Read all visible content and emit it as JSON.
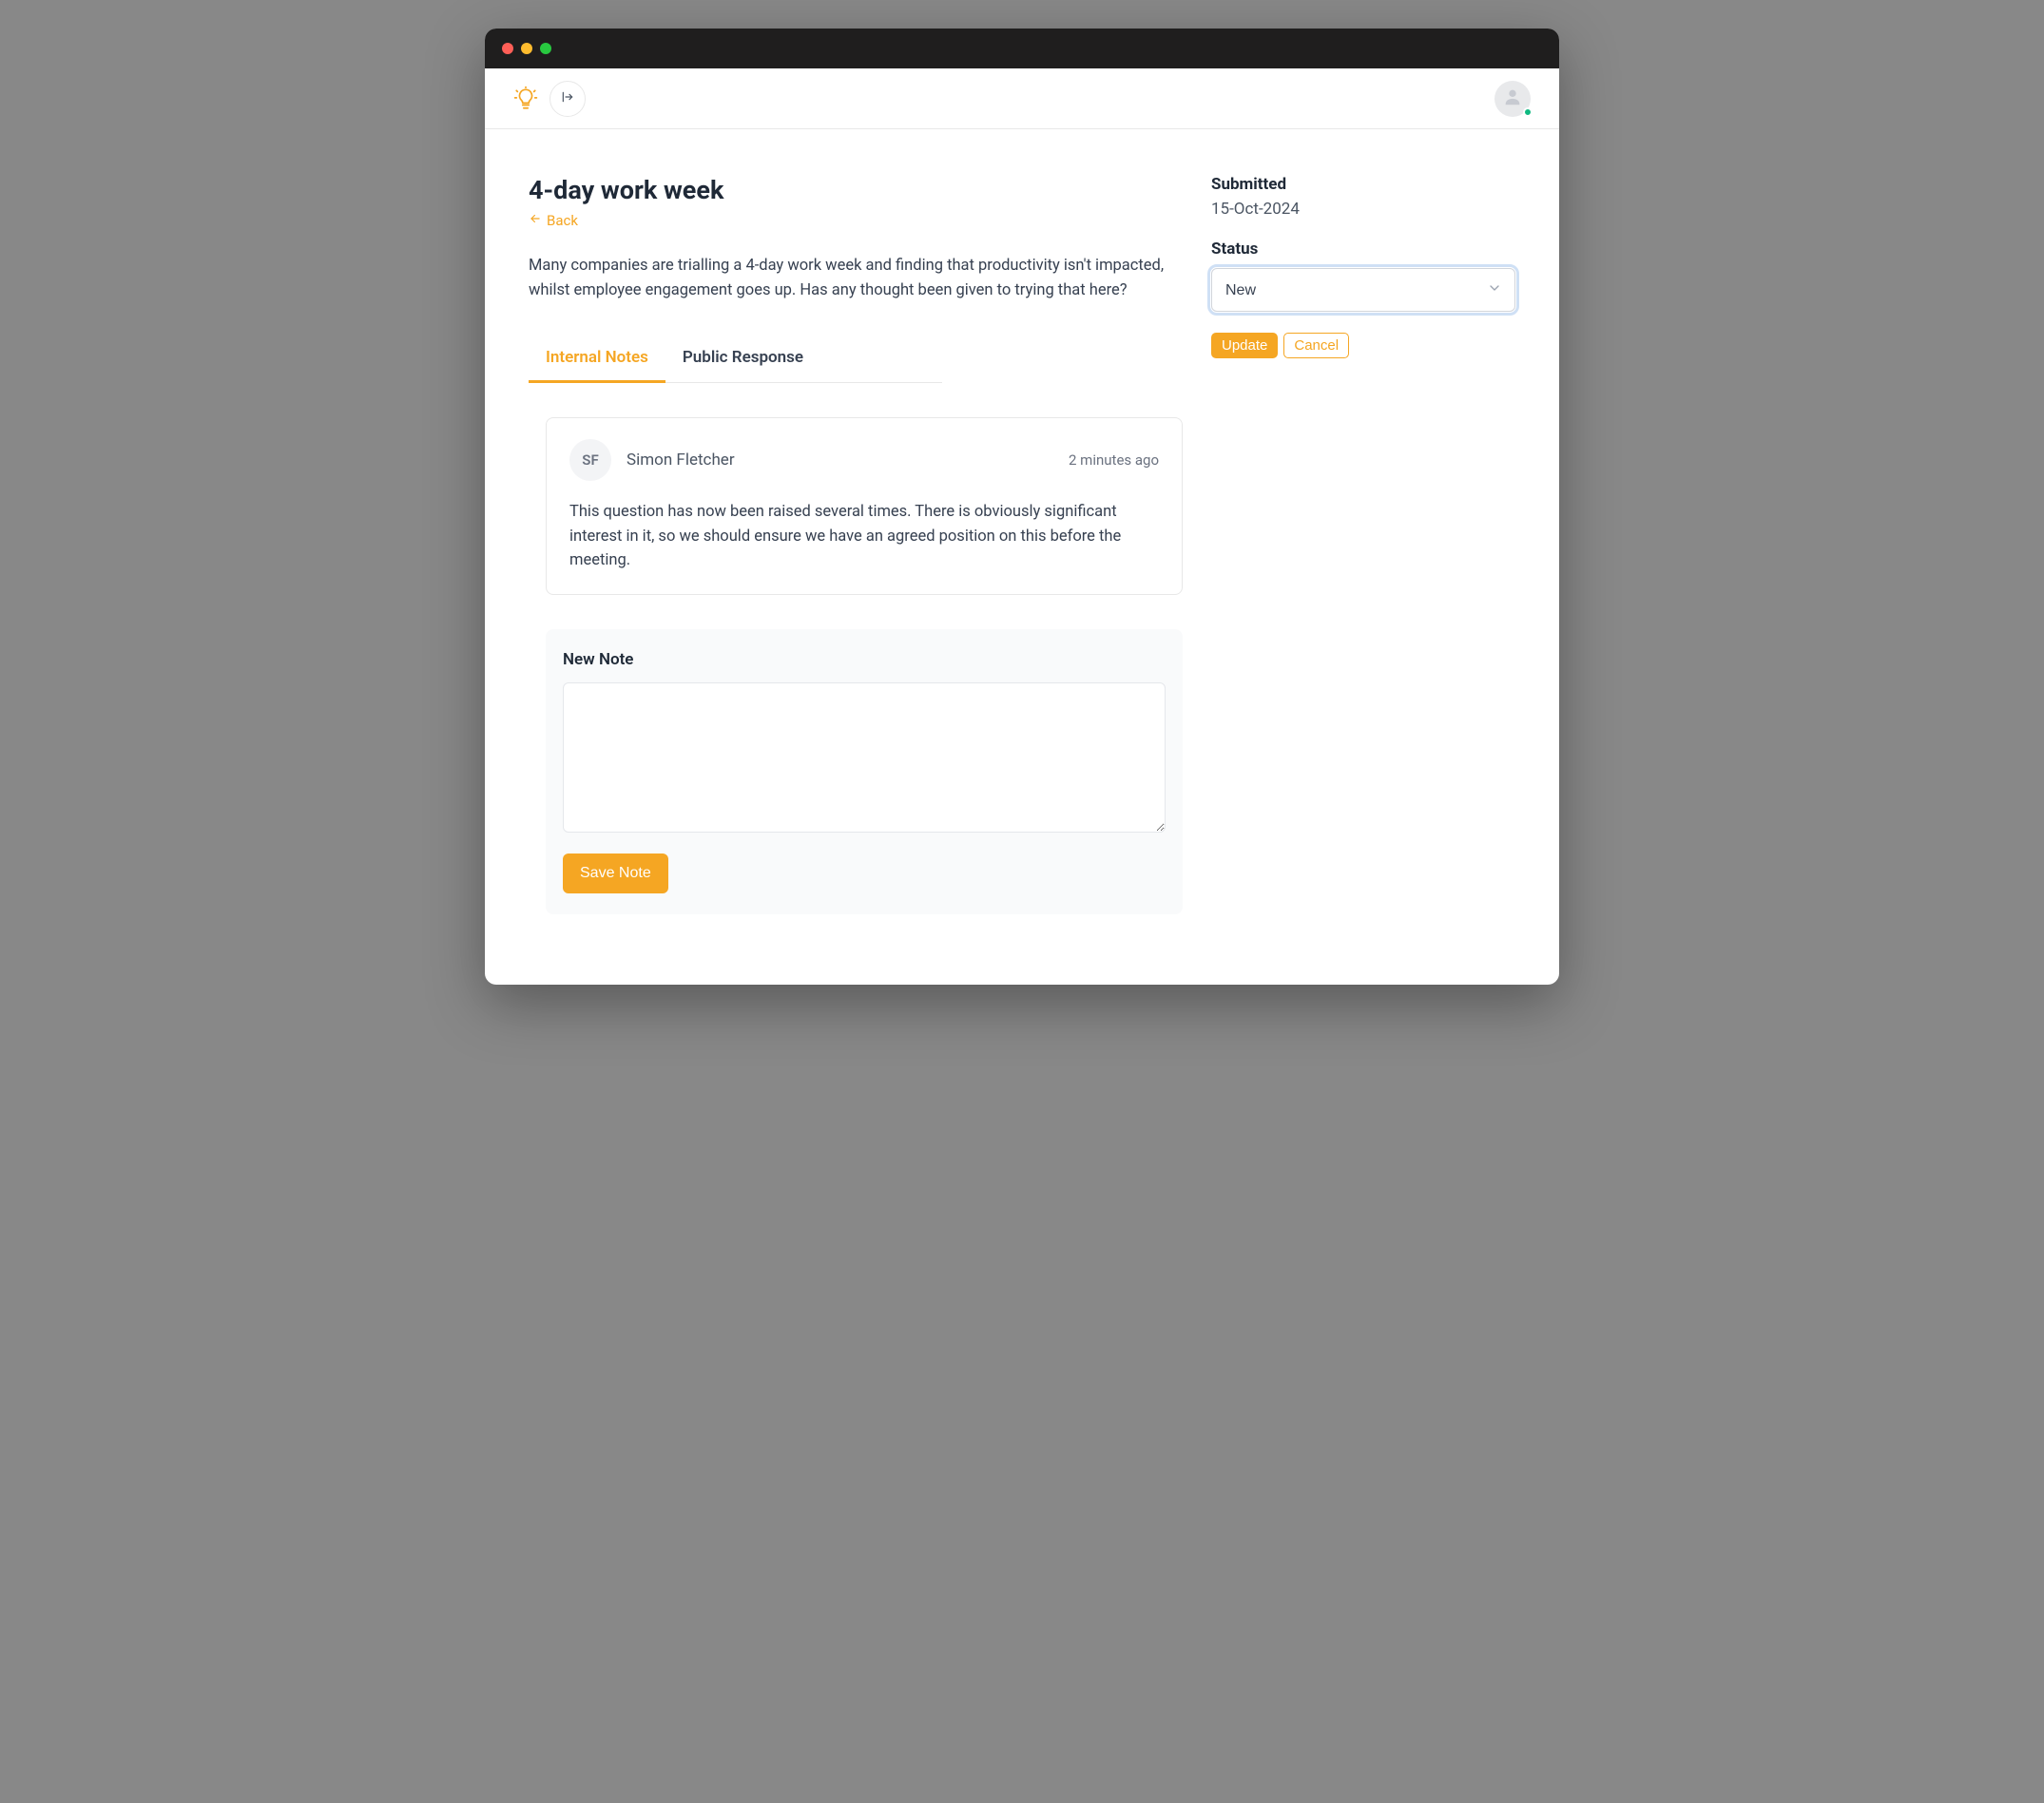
{
  "page": {
    "title": "4-day work week",
    "back_label": "Back",
    "description": "Many companies are trialling a 4-day work week and finding that productivity isn't impacted, whilst employee engagement goes up.  Has any thought been given to trying that here?"
  },
  "tabs": {
    "internal_notes": "Internal Notes",
    "public_response": "Public Response"
  },
  "note": {
    "initials": "SF",
    "author": "Simon Fletcher",
    "time": "2 minutes ago",
    "body": "This question has now been raised several times. There is obviously significant interest in it, so we should ensure we have an agreed position on this before the meeting."
  },
  "new_note": {
    "label": "New Note",
    "save_label": "Save Note",
    "value": ""
  },
  "sidebar": {
    "submitted_label": "Submitted",
    "submitted_value": "15-Oct-2024",
    "status_label": "Status",
    "status_value": "New",
    "update_label": "Update",
    "cancel_label": "Cancel"
  }
}
